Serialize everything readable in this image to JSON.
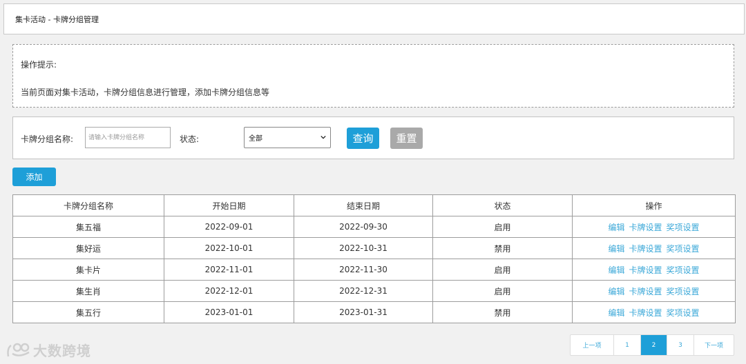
{
  "header": {
    "title": "集卡活动 - 卡牌分组管理"
  },
  "tips": {
    "title": "操作提示:",
    "text": "当前页面对集卡活动，卡牌分组信息进行管理，添加卡牌分组信息等"
  },
  "search": {
    "name_label": "卡牌分组名称:",
    "name_placeholder": "请输入卡牌分组名称",
    "status_label": "状态:",
    "status_selected": "全部",
    "query_label": "查询",
    "reset_label": "重置"
  },
  "toolbar": {
    "add_label": "添加"
  },
  "table": {
    "columns": [
      "卡牌分组名称",
      "开始日期",
      "结束日期",
      "状态",
      "操作"
    ],
    "rows": [
      {
        "name": "集五福",
        "start": "2022-09-01",
        "end": "2022-09-30",
        "status": "启用"
      },
      {
        "name": "集好运",
        "start": "2022-10-01",
        "end": "2022-10-31",
        "status": "禁用"
      },
      {
        "name": "集卡片",
        "start": "2022-11-01",
        "end": "2022-11-30",
        "status": "启用"
      },
      {
        "name": "集生肖",
        "start": "2022-12-01",
        "end": "2022-12-31",
        "status": "启用"
      },
      {
        "name": "集五行",
        "start": "2023-01-01",
        "end": "2023-01-31",
        "status": "禁用"
      }
    ],
    "actions": {
      "edit": "编辑",
      "card_settings": "卡牌设置",
      "prize_settings": "奖项设置"
    }
  },
  "pagination": {
    "prev": "上一项",
    "pages": [
      "1",
      "2",
      "3"
    ],
    "current": "2",
    "next": "下一项"
  },
  "watermark": {
    "text": "大数跨境"
  },
  "colors": {
    "primary": "#1e9fd8",
    "link": "#3ba8d8",
    "disabled": "#a9a9a9"
  }
}
